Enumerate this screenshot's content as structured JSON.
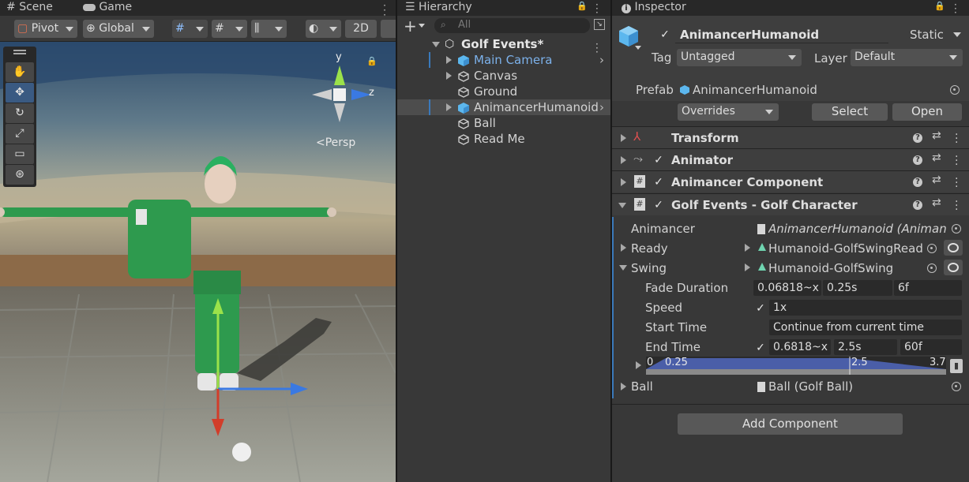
{
  "scene": {
    "tabs": [
      {
        "label": "Scene",
        "icon": "grid-icon"
      },
      {
        "label": "Game",
        "icon": "gamepad-icon"
      }
    ],
    "toolbar": {
      "pivot": "Pivot",
      "global": "Global",
      "mode_2d": "2D"
    },
    "gizmo": {
      "y": "y",
      "z": "z",
      "persp": "<Persp"
    },
    "tools": [
      "hand-tool",
      "move-tool",
      "rotate-tool",
      "scale-tool",
      "rect-tool",
      "transform-tool"
    ]
  },
  "hierarchy": {
    "title": "Hierarchy",
    "search_placeholder": "All",
    "scene_name": "Golf Events*",
    "items": [
      {
        "label": "Main Camera",
        "icon": "prefab-cube-icon",
        "expandable": true
      },
      {
        "label": "Canvas",
        "icon": "gameobject-cube-icon",
        "expandable": true
      },
      {
        "label": "Ground",
        "icon": "gameobject-cube-icon",
        "expandable": false
      },
      {
        "label": "AnimancerHumanoid",
        "icon": "prefab-cube-icon",
        "expandable": true
      },
      {
        "label": "Ball",
        "icon": "gameobject-cube-icon",
        "expandable": false
      },
      {
        "label": "Read Me",
        "icon": "gameobject-cube-icon",
        "expandable": false
      }
    ]
  },
  "inspector": {
    "title": "Inspector",
    "object_name": "AnimancerHumanoid",
    "static_label": "Static",
    "tag_label": "Tag",
    "tag_value": "Untagged",
    "layer_label": "Layer",
    "layer_value": "Default",
    "prefab_label": "Prefab",
    "prefab_value": "AnimancerHumanoid",
    "overrides": "Overrides",
    "select": "Select",
    "open": "Open",
    "components": [
      {
        "name": "Transform",
        "icon": "transform-icon",
        "checkbox": false
      },
      {
        "name": "Animator",
        "icon": "animator-icon",
        "checkbox": true
      },
      {
        "name": "Animancer Component",
        "icon": "script-icon",
        "checkbox": true
      },
      {
        "name": "Golf Events - Golf Character",
        "icon": "script-icon",
        "checkbox": true
      }
    ],
    "fields": {
      "animancer_label": "Animancer",
      "animancer_value": "AnimancerHumanoid (Animancer",
      "ready_label": "Ready",
      "ready_value": "Humanoid-GolfSwingReady",
      "swing_label": "Swing",
      "swing_value": "Humanoid-GolfSwing",
      "fade_label": "Fade Duration",
      "fade_x": "0.06818~x",
      "fade_s": "0.25s",
      "fade_f": "6f",
      "speed_label": "Speed",
      "speed_value": "1x",
      "start_label": "Start Time",
      "start_value": "Continue from current time",
      "end_label": "End Time",
      "end_x": "0.6818~x",
      "end_s": "2.5s",
      "end_f": "60f",
      "timeline": {
        "t0": "0",
        "t1": "0.25",
        "t2": "2.5",
        "t3": "3.7"
      },
      "ball_label": "Ball",
      "ball_value": "Ball (Golf Ball)"
    },
    "add_component": "Add Component"
  },
  "colors": {
    "accent": "#3a79bb",
    "selection": "#4d4d4d",
    "highlight_text": "#7cb1ea"
  }
}
